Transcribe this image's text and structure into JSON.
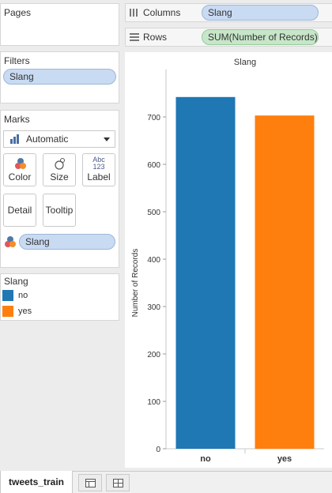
{
  "pages": {
    "title": "Pages"
  },
  "shelves": {
    "columns": {
      "label": "Columns",
      "pill": "Slang"
    },
    "rows": {
      "label": "Rows",
      "pill": "SUM(Number of Records)"
    }
  },
  "filters": {
    "title": "Filters",
    "pill": "Slang"
  },
  "marks": {
    "title": "Marks",
    "mark_type": "Automatic",
    "buttons": {
      "color": "Color",
      "size": "Size",
      "label": "Label",
      "label_icon_top": "Abc",
      "label_icon_bottom": "123",
      "detail": "Detail",
      "tooltip": "Tooltip"
    },
    "color_pill": "Slang"
  },
  "legend": {
    "title": "Slang",
    "items": [
      {
        "label": "no",
        "color": "#1f77b4"
      },
      {
        "label": "yes",
        "color": "#ff7f0e"
      }
    ]
  },
  "colors": {
    "no": "#1f77b4",
    "yes": "#ff7f0e",
    "pill_blue": "#c9daf3",
    "pill_green": "#c7e6c9"
  },
  "chart_data": {
    "type": "bar",
    "title": "Slang",
    "categories": [
      "no",
      "yes"
    ],
    "values": [
      742,
      703
    ],
    "colors": [
      "#1f77b4",
      "#ff7f0e"
    ],
    "ylabel": "Number of Records",
    "xlabel": "",
    "ylim": [
      0,
      800
    ],
    "yticks": [
      0,
      100,
      200,
      300,
      400,
      500,
      600,
      700
    ],
    "grid": false
  },
  "bottom": {
    "sheet_tab": "tweets_train"
  }
}
